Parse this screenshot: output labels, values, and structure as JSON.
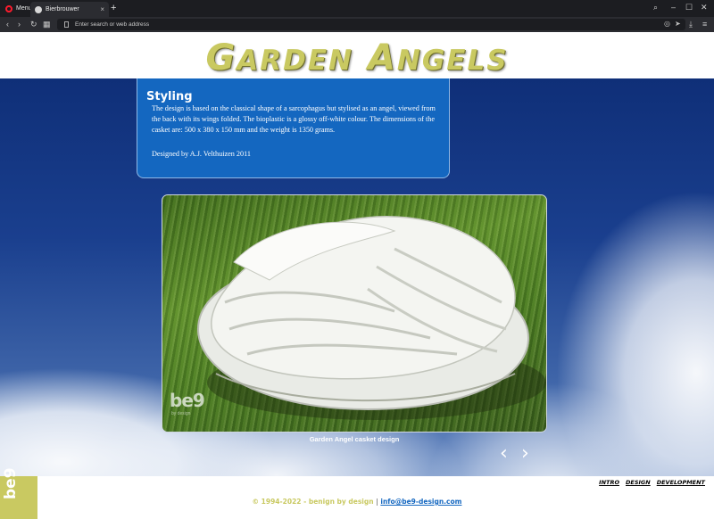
{
  "browser": {
    "menu_label": "Menu",
    "tab_title": "Bierbrouwer",
    "tab_close": "×",
    "new_tab": "+",
    "address_placeholder": "Enter search or web address",
    "accent": "#ff1b2d"
  },
  "site": {
    "logo_initial_1": "G",
    "logo_rest_1": "ARDEN",
    "logo_initial_2": "A",
    "logo_rest_2": "NGELS",
    "logo_color": "#c9c961",
    "info": {
      "title": "Styling",
      "text": "The design is based on the classical shape of a sarcophagus but stylised as an angel, viewed from the back with its wings folded. The bioplastic is a glossy off-white colour. The dimensions of the casket are: 500 x 380 x 150 mm and the weight is 1350 grams.",
      "credit": "Designed by A.J. Velthuizen 2011"
    },
    "photo": {
      "watermark": "be9",
      "watermark_sub": "by design",
      "caption": "Garden Angel casket design"
    },
    "gallery": {
      "prev": "‹",
      "next": "›"
    },
    "footer": {
      "badge": "be9",
      "nav": [
        "INTRO",
        "DESIGN",
        "DEVELOPMENT"
      ],
      "copyright": "© 1994-2022 - benign by design",
      "separator": "|",
      "email": "info@be9-design.com"
    },
    "colors": {
      "info_box": "#1467c0",
      "badge": "#c9c961"
    }
  }
}
